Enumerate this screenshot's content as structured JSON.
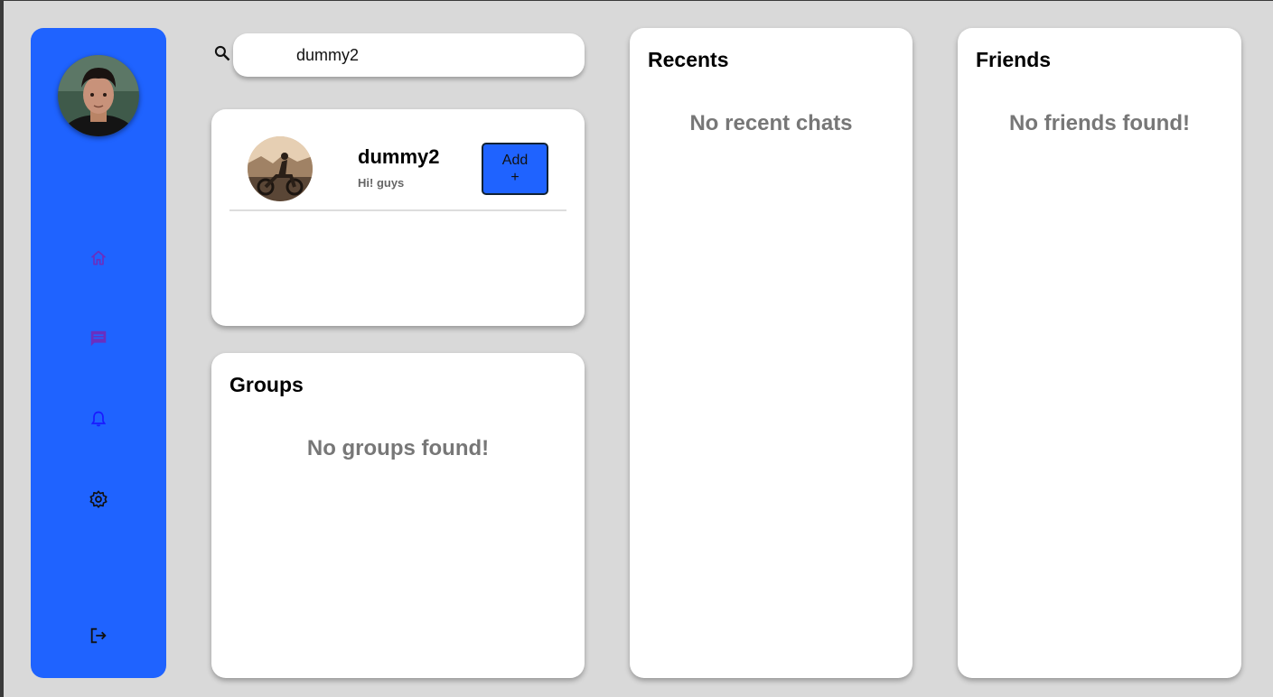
{
  "search": {
    "value": "dummy2",
    "placeholder": ""
  },
  "sidebar": {
    "icons": [
      "home-icon",
      "chat-icon",
      "bell-icon",
      "settings-icon",
      "logout-icon"
    ],
    "colors": {
      "bg": "#1f63ff",
      "home": "#6a2fbf",
      "chat": "#6a2fbf",
      "bell": "#1a1aff",
      "settings": "#111111"
    }
  },
  "result": {
    "name": "dummy2",
    "status": "Hi! guys",
    "add_label": "Add\n+"
  },
  "groups": {
    "title": "Groups",
    "empty": "No groups found!"
  },
  "recents": {
    "title": "Recents",
    "empty": "No recent chats"
  },
  "friends": {
    "title": "Friends",
    "empty": "No friends found!"
  }
}
